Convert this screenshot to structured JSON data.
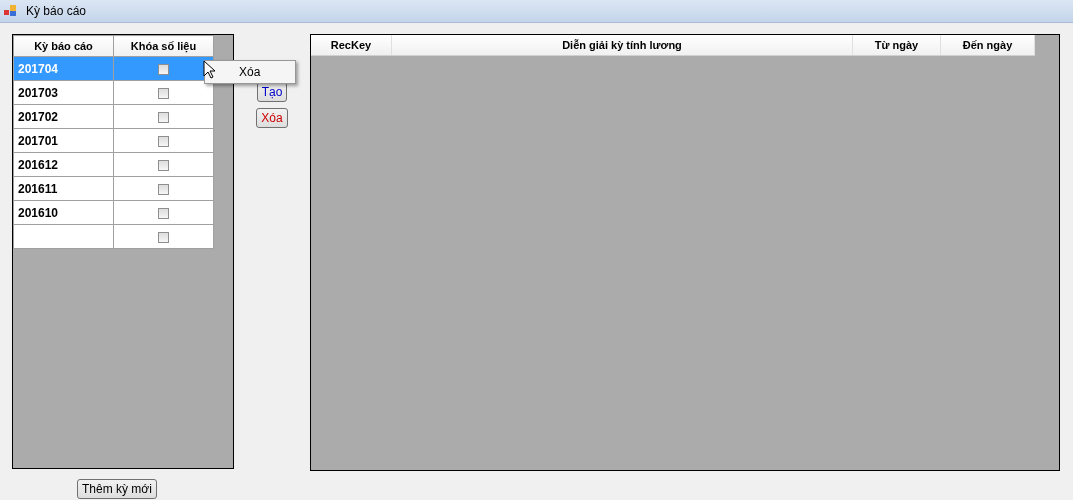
{
  "window": {
    "title": "Kỳ báo cáo"
  },
  "periods_grid": {
    "columns": [
      "Kỳ báo cáo",
      "Khóa số liệu"
    ],
    "rows": [
      {
        "period": "201704",
        "locked": false,
        "selected": true
      },
      {
        "period": "201703",
        "locked": false,
        "selected": false
      },
      {
        "period": "201702",
        "locked": false,
        "selected": false
      },
      {
        "period": "201701",
        "locked": false,
        "selected": false
      },
      {
        "period": "201612",
        "locked": false,
        "selected": false
      },
      {
        "period": "201611",
        "locked": false,
        "selected": false
      },
      {
        "period": "201610",
        "locked": false,
        "selected": false
      },
      {
        "period": "",
        "locked": false,
        "selected": false
      }
    ]
  },
  "context_menu": {
    "items": [
      "Xóa"
    ]
  },
  "buttons": [
    {
      "label": "Tạo",
      "kind": "create"
    },
    {
      "label": "Xóa",
      "kind": "delete"
    }
  ],
  "detail_grid": {
    "columns": [
      "RecKey",
      "Diễn giải kỳ tính lương",
      "Từ ngày",
      "Đến ngày"
    ]
  },
  "add_button": {
    "label": "Thêm kỳ mới"
  }
}
